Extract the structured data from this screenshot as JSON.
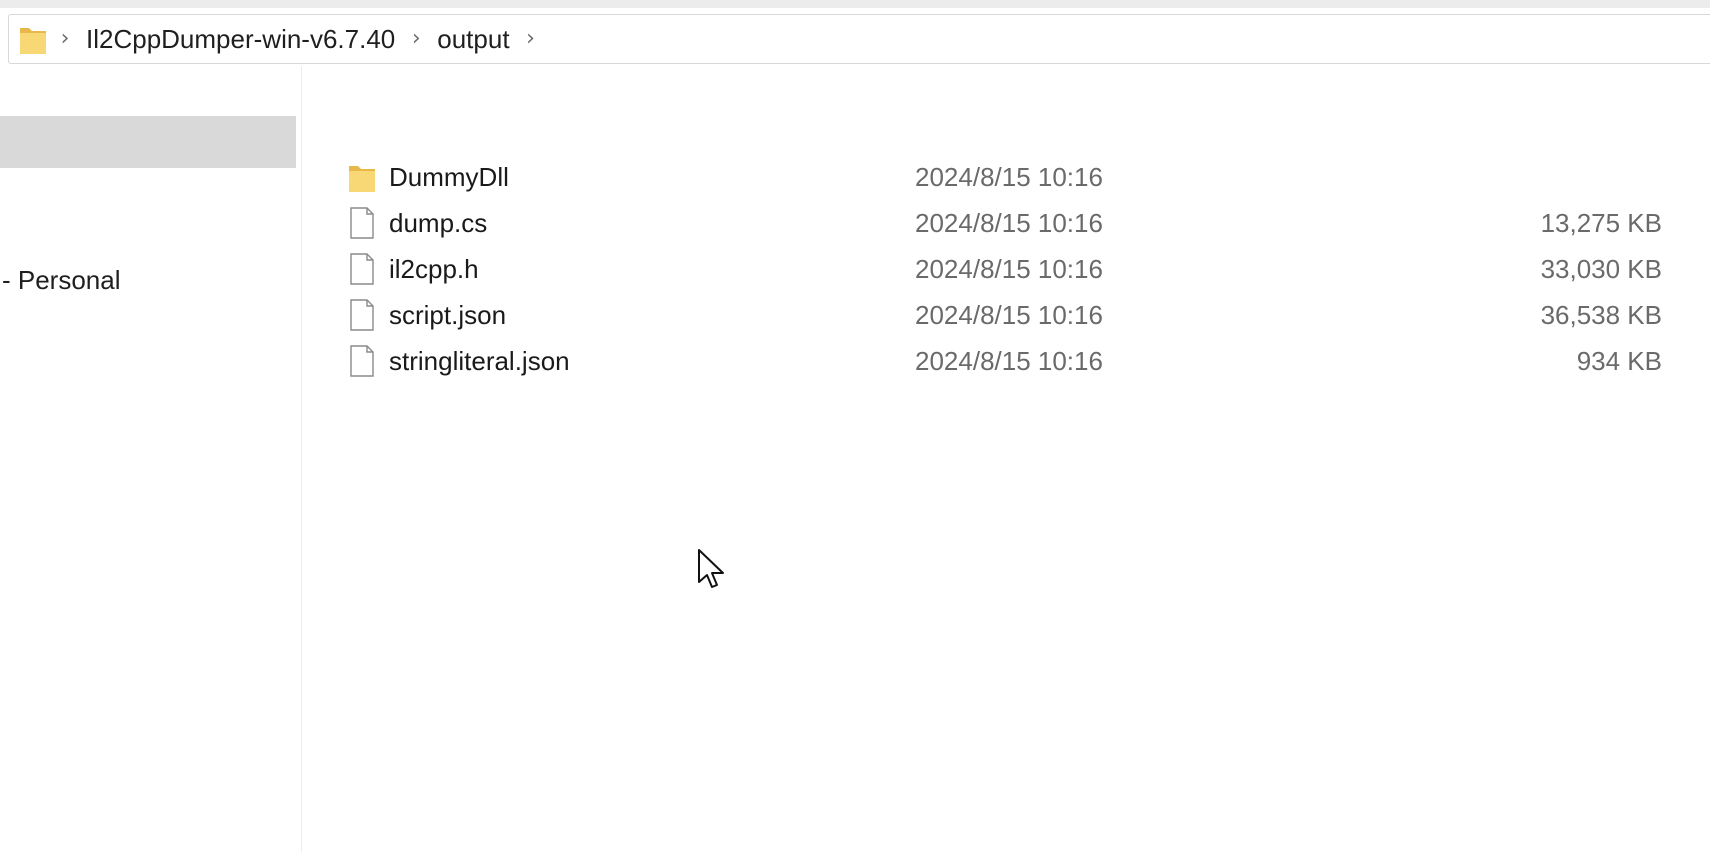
{
  "breadcrumb": {
    "folder_icon": "folder-icon",
    "separator": "›",
    "items": [
      {
        "label": "Il2CppDumper-win-v6.7.40"
      },
      {
        "label": "output"
      }
    ]
  },
  "nav_pane": {
    "selected_item_label": "",
    "item_label": "- Personal"
  },
  "files": [
    {
      "name": "DummyDll",
      "icon": "folder-icon",
      "date": "2024/8/15 10:16",
      "size": ""
    },
    {
      "name": "dump.cs",
      "icon": "file-icon",
      "date": "2024/8/15 10:16",
      "size": "13,275 KB"
    },
    {
      "name": "il2cpp.h",
      "icon": "file-icon",
      "date": "2024/8/15 10:16",
      "size": "33,030 KB"
    },
    {
      "name": "script.json",
      "icon": "file-icon",
      "date": "2024/8/15 10:16",
      "size": "36,538 KB"
    },
    {
      "name": "stringliteral.json",
      "icon": "file-icon",
      "date": "2024/8/15 10:16",
      "size": "934 KB"
    }
  ],
  "colors": {
    "folder": "#f8d775",
    "folder_dark": "#e8b84a",
    "selection": "#d9d9d9"
  }
}
